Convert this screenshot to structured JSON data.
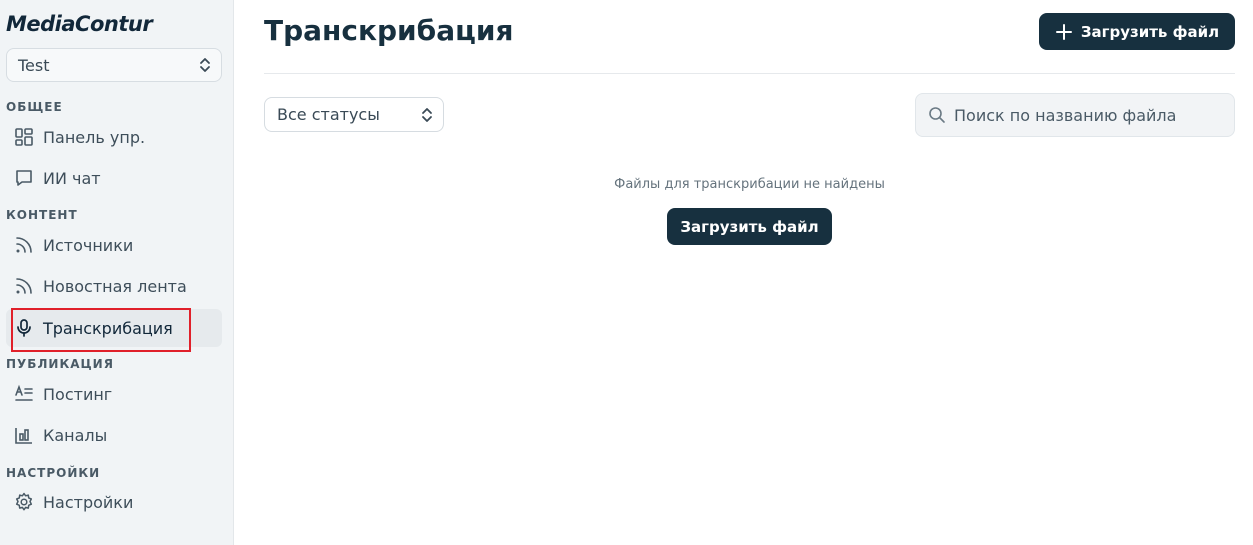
{
  "sidebar": {
    "logo": "MediaContur",
    "workspace": "Test",
    "sections": [
      {
        "title": "ОБЩЕЕ",
        "items": [
          {
            "label": "Панель упр.",
            "icon": "dashboard-icon"
          },
          {
            "label": "ИИ чат",
            "icon": "chat-icon"
          }
        ]
      },
      {
        "title": "КОНТЕНТ",
        "items": [
          {
            "label": "Источники",
            "icon": "rss-icon"
          },
          {
            "label": "Новостная лента",
            "icon": "rss-icon"
          },
          {
            "label": "Транскрибация",
            "icon": "microphone-icon",
            "active": true
          }
        ]
      },
      {
        "title": "ПУБЛИКАЦИЯ",
        "items": [
          {
            "label": "Постинг",
            "icon": "text-align-icon"
          },
          {
            "label": "Каналы",
            "icon": "bar-chart-icon"
          }
        ]
      },
      {
        "title": "НАСТРОЙКИ",
        "items": [
          {
            "label": "Настройки",
            "icon": "gear-icon"
          }
        ]
      }
    ]
  },
  "main": {
    "title": "Транскрибация",
    "upload_button": "Загрузить файл",
    "status_filter": "Все статусы",
    "search_placeholder": "Поиск по названию файла",
    "empty_message": "Файлы для транскрибации не найдены",
    "empty_upload_button": "Загрузить файл"
  },
  "colors": {
    "primary": "#17303f",
    "sidebar_bg": "#f1f4f6",
    "highlight": "#e0202a"
  }
}
